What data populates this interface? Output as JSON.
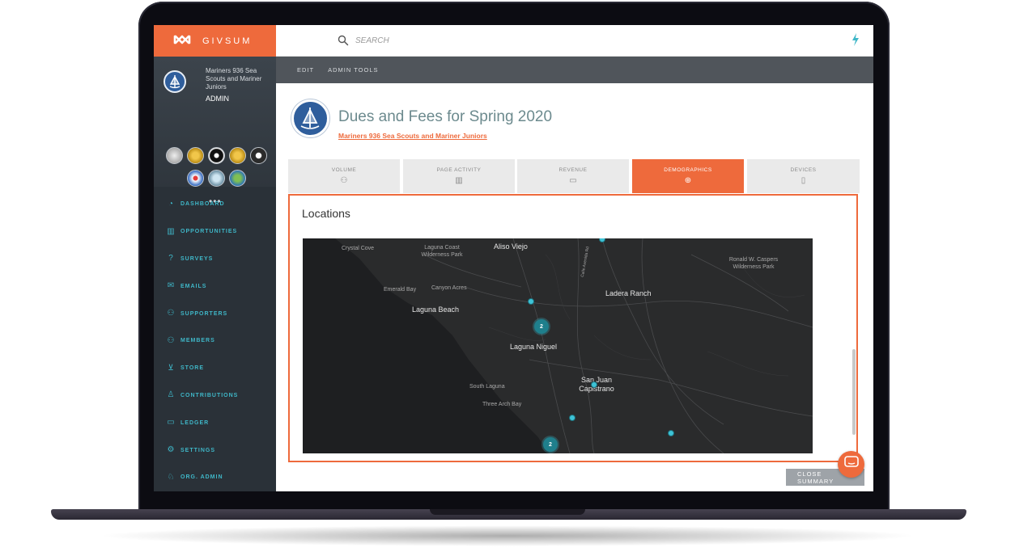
{
  "brand": {
    "name": "GIVSUM",
    "accent": "#ee6a3c",
    "teal": "#3fb7c8"
  },
  "org": {
    "name": "Mariners 936 Sea Scouts and Mariner Juniors",
    "role": "ADMIN",
    "more": "•••",
    "badges": [
      "silver-badge",
      "gold-badge",
      "black-white-badge",
      "gold-badge",
      "shield-badge",
      "red-blue-badge",
      "scenic-badge",
      "earth-badge"
    ]
  },
  "nav": [
    {
      "label": "DASHBOARD",
      "icon": "dashboard-icon"
    },
    {
      "label": "OPPORTUNITIES",
      "icon": "opportunities-icon"
    },
    {
      "label": "SURVEYS",
      "icon": "surveys-icon"
    },
    {
      "label": "EMAILS",
      "icon": "emails-icon"
    },
    {
      "label": "SUPPORTERS",
      "icon": "supporters-icon"
    },
    {
      "label": "MEMBERS",
      "icon": "members-icon"
    },
    {
      "label": "STORE",
      "icon": "store-icon"
    },
    {
      "label": "CONTRIBUTIONS",
      "icon": "contributions-icon"
    },
    {
      "label": "LEDGER",
      "icon": "ledger-icon"
    },
    {
      "label": "SETTINGS",
      "icon": "settings-icon"
    },
    {
      "label": "ORG. ADMIN",
      "icon": "org-admin-icon"
    }
  ],
  "search": {
    "placeholder": "SEARCH"
  },
  "actions": {
    "edit": "EDIT",
    "admin_tools": "ADMIN TOOLS"
  },
  "campaign": {
    "title": "Dues and Fees for Spring 2020",
    "org_link": "Mariners 936 Sea Scouts and Mariner Juniors"
  },
  "tabs": [
    {
      "label": "VOLUME",
      "icon": "volume-icon",
      "active": false
    },
    {
      "label": "PAGE ACTIVITY",
      "icon": "page-activity-icon",
      "active": false
    },
    {
      "label": "REVENUE",
      "icon": "revenue-icon",
      "active": false
    },
    {
      "label": "DEMOGRAPHICS",
      "icon": "demographics-icon",
      "active": true
    },
    {
      "label": "DEVICES",
      "icon": "devices-icon",
      "active": false
    }
  ],
  "panel": {
    "title": "Locations"
  },
  "map": {
    "labels": [
      {
        "text": "Crystal Cove",
        "kind": "minor"
      },
      {
        "text": "Laguna Coast Wilderness Park",
        "kind": "minor"
      },
      {
        "text": "Aliso Viejo",
        "kind": "major"
      },
      {
        "text": "Calle Avenida Rd",
        "kind": "road"
      },
      {
        "text": "Ronald W. Caspers Wilderness Park",
        "kind": "minor"
      },
      {
        "text": "Emerald Bay",
        "kind": "minor"
      },
      {
        "text": "Canyon Acres",
        "kind": "minor"
      },
      {
        "text": "Laguna Beach",
        "kind": "major"
      },
      {
        "text": "Ladera Ranch",
        "kind": "major"
      },
      {
        "text": "Laguna Niguel",
        "kind": "major"
      },
      {
        "text": "San Juan Capistrano",
        "kind": "major"
      },
      {
        "text": "South Laguna",
        "kind": "minor"
      },
      {
        "text": "Three Arch Bay",
        "kind": "minor"
      }
    ],
    "clusters": [
      {
        "count": "2"
      },
      {
        "count": "2"
      }
    ]
  },
  "footer": {
    "close_label": "CLOSE SUMMARY"
  }
}
